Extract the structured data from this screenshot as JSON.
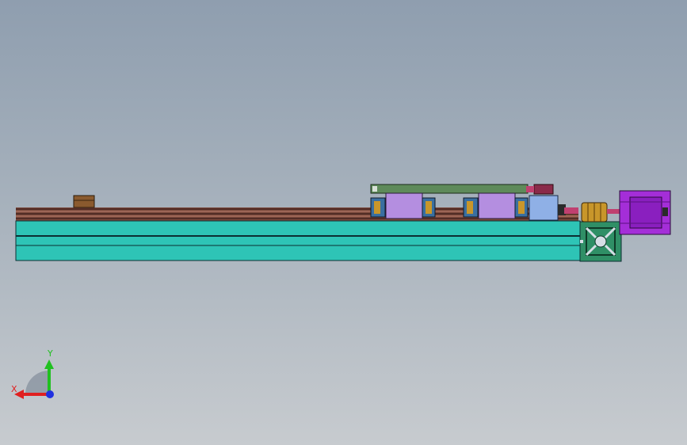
{
  "colors": {
    "background_top": "#8f9eaf",
    "background_bottom": "#c7cbcf",
    "rail_body": "#2ec4b6",
    "rail_dark_line": "#0c2f33",
    "screw_stripe": "#8a5a4a",
    "carriage_plate": "#5e8a5a",
    "bearing_block": "#b48ee0",
    "bearing_cap": "#3a6fa0",
    "coupling": "#c8962a",
    "motor_body": "#a42ed8",
    "motor_flange": "#8a1fbf",
    "end_plate": "#2f8f66",
    "bracket": "#8fb0e6",
    "stop_block": "#8a5a2e",
    "axis_x": "#e02020",
    "axis_y": "#20c020",
    "axis_z": "#2030e0"
  },
  "triad": {
    "x_label": "X",
    "y_label": "Y",
    "x_icon": "x-axis-arrow-icon",
    "y_icon": "y-axis-arrow-icon",
    "z_icon": "z-axis-dot-icon"
  }
}
